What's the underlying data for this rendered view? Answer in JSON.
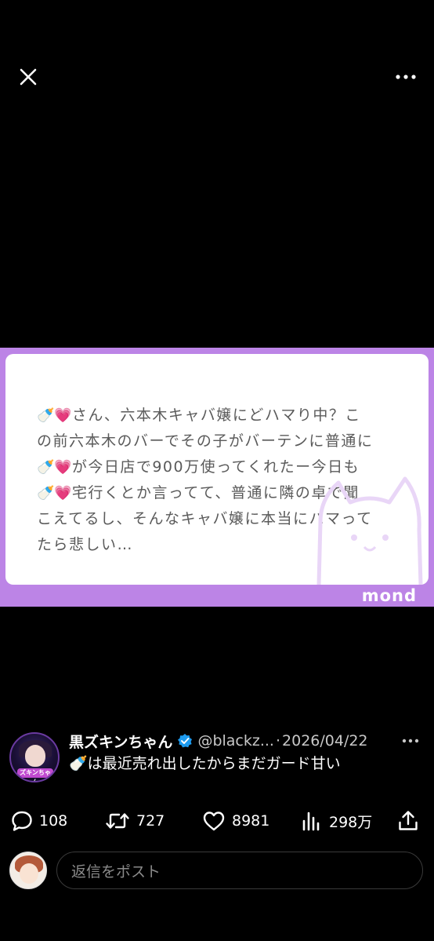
{
  "card": {
    "lines": [
      {
        "emoji": "🍼💗",
        "text": "さん、六本木キャバ嬢にどハマり中？こ"
      },
      {
        "emoji": "",
        "text": "の前六本木のバーでその子がバーテンに普通に"
      },
      {
        "emoji": "🍼💗",
        "text": "が今日店で900万使ってくれたー今日も"
      },
      {
        "emoji": "🍼💗",
        "text": "宅行くとか言ってて、普通に隣の卓で聞"
      },
      {
        "emoji": "",
        "text": "こえてるし、そんなキャバ嬢に本当にハマって"
      },
      {
        "emoji": "",
        "text": "たら悲しい…"
      }
    ],
    "brand": "mond",
    "frame_color": "#bc84e6"
  },
  "tweet": {
    "display_name": "黒ズキンちゃん",
    "handle": "@blackz...",
    "separator": "·",
    "date": "2026/04/22",
    "text": "🍼は最近売れ出したからまだガード甘い",
    "avatar_label": "ズキンちゃん",
    "verified_color": "#1d9bf0"
  },
  "actions": {
    "replies": "108",
    "retweets": "727",
    "likes": "8981",
    "views": "298万"
  },
  "reply": {
    "placeholder": "返信をポスト"
  },
  "icons": {
    "close": "close-icon",
    "more": "more-horizontal-icon",
    "reply": "reply-icon",
    "retweet": "retweet-icon",
    "like": "heart-icon",
    "views": "views-chart-icon",
    "share": "share-icon"
  }
}
